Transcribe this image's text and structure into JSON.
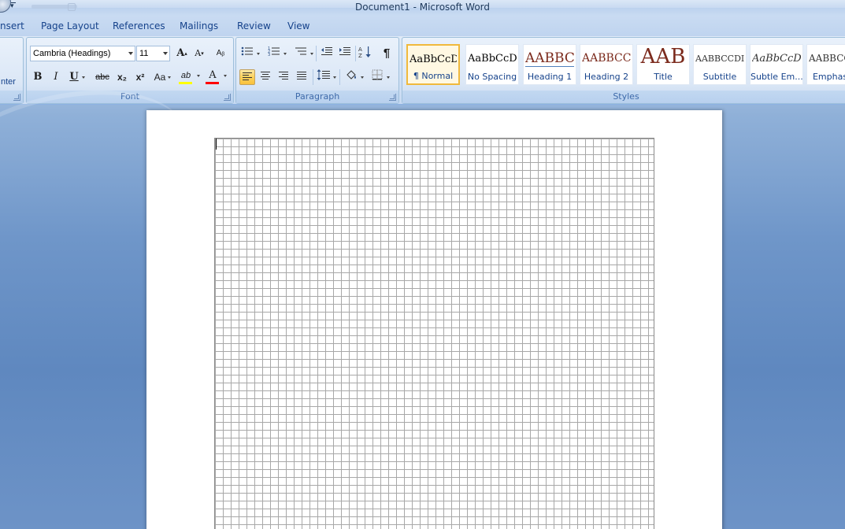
{
  "window": {
    "title": "Document1 - Microsoft Word"
  },
  "tabs": [
    {
      "label": "nsert"
    },
    {
      "label": "Page Layout"
    },
    {
      "label": "References"
    },
    {
      "label": "Mailings"
    },
    {
      "label": "Review"
    },
    {
      "label": "View"
    }
  ],
  "clipboard": {
    "partial_label": "nter"
  },
  "font_group": {
    "label": "Font",
    "font_name": "Cambria (Headings)",
    "font_size": "11",
    "bold": "B",
    "italic": "I",
    "underline": "U",
    "strikethrough": "abc",
    "subscript": "x₂",
    "superscript": "x²",
    "change_case": "Aa",
    "highlight": "ab",
    "font_color": "A",
    "highlight_color": "#ffff00",
    "font_color_value": "#ff0000"
  },
  "paragraph_group": {
    "label": "Paragraph",
    "show_marks": "¶",
    "sort": "A↓Z",
    "active_alignment": "align-left"
  },
  "styles_group": {
    "label": "Styles",
    "items": [
      {
        "sample": "AaBbCcD",
        "name": "¶ Normal",
        "selected": true
      },
      {
        "sample": "AaBbCcD",
        "name": "No Spacing"
      },
      {
        "sample": "AABBC",
        "name": "Heading 1"
      },
      {
        "sample": "AABBCC",
        "name": "Heading 2"
      },
      {
        "sample": "AAB",
        "name": "Title"
      },
      {
        "sample": "AABBCCDI",
        "name": "Subtitle"
      },
      {
        "sample": "AaBbCcD",
        "name": "Subtle Em..."
      },
      {
        "sample": "AABBCC",
        "name": "Emphas"
      }
    ]
  },
  "colors": {
    "accent": "#15428b",
    "selected_style_border": "#f0b93c",
    "heading_text": "#7b2a1c"
  }
}
